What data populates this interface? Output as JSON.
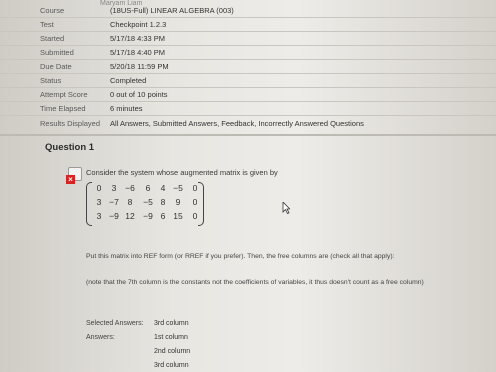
{
  "header": {
    "top_fragment": "Maryam Liam"
  },
  "info": [
    {
      "label": "Course",
      "value": "(18US-Full) LINEAR ALGEBRA (003)"
    },
    {
      "label": "Test",
      "value": "Checkpoint 1.2.3"
    },
    {
      "label": "Started",
      "value": "5/17/18 4:33 PM"
    },
    {
      "label": "Submitted",
      "value": "5/17/18 4:40 PM"
    },
    {
      "label": "Due Date",
      "value": "5/20/18 11:59 PM"
    },
    {
      "label": "Status",
      "value": "Completed"
    },
    {
      "label": "Attempt Score",
      "value": "0 out of 10 points"
    },
    {
      "label": "Time Elapsed",
      "value": "6 minutes"
    },
    {
      "label": "Results Displayed",
      "value": "All Answers, Submitted Answers, Feedback, Incorrectly Answered Questions"
    }
  ],
  "question": {
    "title": "Question 1",
    "prompt": "Consider the system whose augmented matrix is given by",
    "matrix": [
      [
        "0",
        "3",
        "−6",
        "6",
        "4",
        "−5",
        "0"
      ],
      [
        "3",
        "−7",
        "8",
        "−5",
        "8",
        "9",
        "0"
      ],
      [
        "3",
        "−9",
        "12",
        "−9",
        "6",
        "15",
        "0"
      ]
    ],
    "instruction": "Put this matrix into REF form (or RREF if you prefer). Then, the free columns are (check all that apply):",
    "note": "(note that the 7th column is the constants not the coefficients of variables, it thus doesn't count as a free column)",
    "selected_label": "Selected Answers:",
    "selected_value": "3rd column",
    "answers_label": "Answers:",
    "answers": [
      "1st column",
      "2nd column",
      "3rd column"
    ]
  }
}
